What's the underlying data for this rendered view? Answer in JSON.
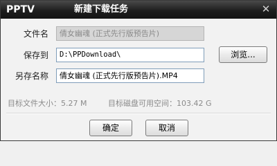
{
  "window": {
    "brand": "PPTV",
    "title": "新建下载任务",
    "close_symbol": "✕"
  },
  "form": {
    "filename_label": "文件名",
    "filename_value": "倩女幽魂 (正式先行版预告片)",
    "saveto_label": "保存到",
    "saveto_value": "D:\\PPDownload\\",
    "browse_label": "浏览...",
    "saveas_label": "另存名称",
    "saveas_value": "倩女幽魂 (正式先行版预告片).MP4"
  },
  "info": {
    "filesize_label": "目标文件大小：",
    "filesize_value": "5.27 M",
    "diskspace_label": "目标磁盘可用空间：",
    "diskspace_value": "103.42 G"
  },
  "buttons": {
    "ok_label": "确定",
    "cancel_label": "取消"
  },
  "colors": {
    "titlebar": "#1e1e1e",
    "disabled_field": "#d6d6d6",
    "info_text": "#8a8a8a"
  }
}
